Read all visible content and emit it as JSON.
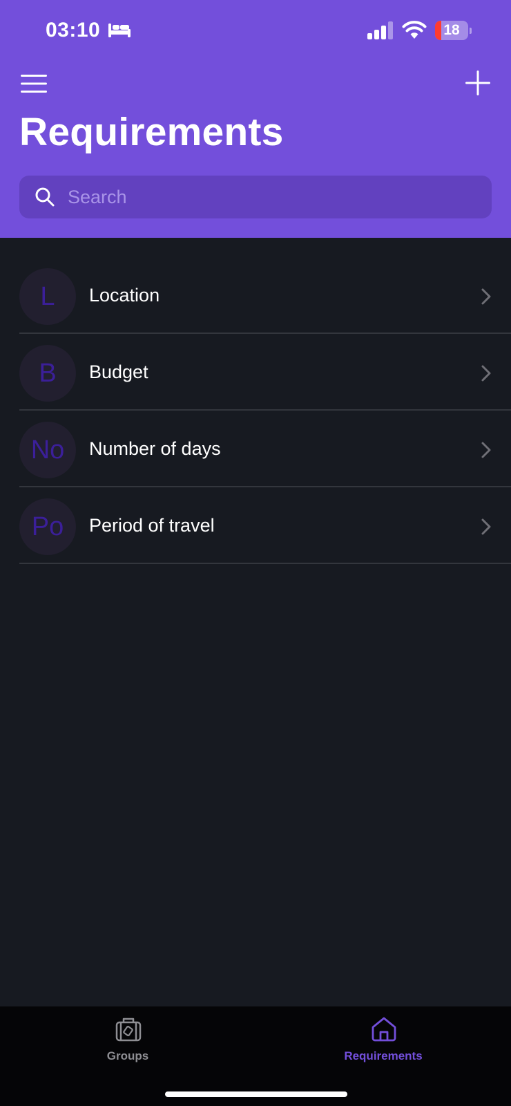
{
  "status_bar": {
    "time": "03:10",
    "battery_level": "18",
    "battery_fraction": 0.18,
    "icons": [
      "bed-icon",
      "cellular-signal-icon",
      "wifi-icon",
      "battery-icon"
    ]
  },
  "header": {
    "title": "Requirements",
    "menu_icon": "hamburger-menu-icon",
    "add_icon": "plus-icon",
    "background_color": "#734fdb"
  },
  "search": {
    "placeholder": "Search",
    "value": ""
  },
  "requirements": [
    {
      "initials": "L",
      "label": "Location"
    },
    {
      "initials": "B",
      "label": "Budget"
    },
    {
      "initials": "No",
      "label": "Number of days"
    },
    {
      "initials": "Po",
      "label": "Period of travel"
    }
  ],
  "tab_bar": {
    "tabs": [
      {
        "label": "Groups",
        "icon": "suitcase-icon",
        "active": false
      },
      {
        "label": "Requirements",
        "icon": "home-icon",
        "active": true
      }
    ],
    "active_color": "#734fdb",
    "inactive_color": "#8e8e93"
  }
}
